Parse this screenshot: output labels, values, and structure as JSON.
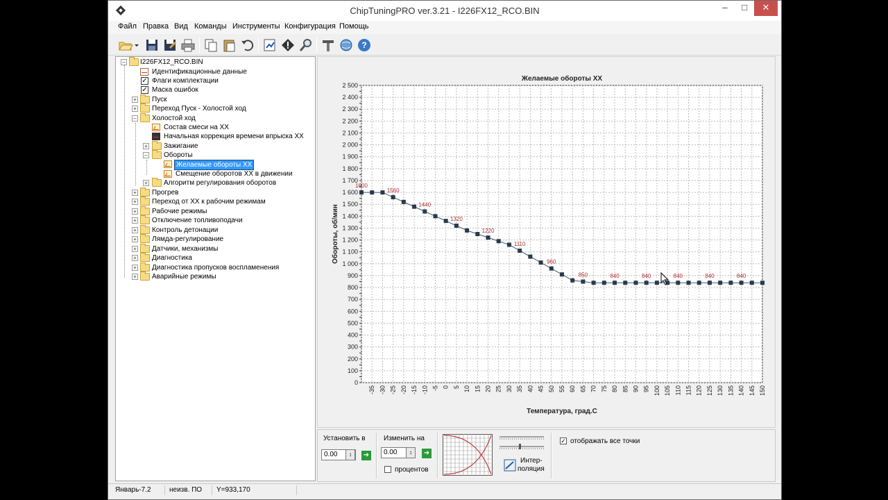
{
  "window": {
    "title": "ChipTuningPRO ver.3.21 - I226FX12_RCO.BIN"
  },
  "menu": [
    "Файл",
    "Правка",
    "Вид",
    "Команды",
    "Инструменты",
    "Конфигурация",
    "Помощь"
  ],
  "toolbar": {
    "icons": [
      "open-icon",
      "dropdown-arrow-icon",
      "save-icon",
      "save-as-icon",
      "print-icon",
      "copy-icon",
      "paste-icon",
      "undo-icon",
      "edit-map-icon",
      "checksum-icon",
      "search-icon",
      "tools-icon",
      "globe-icon",
      "help-icon"
    ]
  },
  "tree": {
    "root": "I226FX12_RCO.BIN",
    "items": [
      {
        "label": "Идентификационные данные"
      },
      {
        "label": "Флаги комплектации"
      },
      {
        "label": "Маска ошибок"
      },
      {
        "label": "Пуск"
      },
      {
        "label": "Переход Пуск - Холостой ход"
      },
      {
        "label": "Холостой ход"
      },
      {
        "label": "Состав смеси на ХХ"
      },
      {
        "label": "Начальная коррекция времени впрыска ХХ"
      },
      {
        "label": "Зажигание"
      },
      {
        "label": "Обороты"
      },
      {
        "label": "Желаемые обороты ХХ"
      },
      {
        "label": "Смещение оборотов ХХ в движении"
      },
      {
        "label": "Алгоритм регулирования оборотов"
      },
      {
        "label": "Прогрев"
      },
      {
        "label": "Переход от ХХ к рабочим режимам"
      },
      {
        "label": "Рабочие режимы"
      },
      {
        "label": "Отключение топливоподачи"
      },
      {
        "label": "Контроль детонации"
      },
      {
        "label": "Лямда-регулирование"
      },
      {
        "label": "Датчики, механизмы"
      },
      {
        "label": "Диагностика"
      },
      {
        "label": "Диагностика пропусков воспламенения"
      },
      {
        "label": "Аварийные режимы"
      }
    ]
  },
  "chart_data": {
    "type": "line",
    "title": "Желаемые обороты ХХ",
    "xlabel": "Температура, град.С",
    "ylabel": "Обороты, об/мин",
    "x": [
      -40,
      -35,
      -30,
      -25,
      -20,
      -15,
      -10,
      -5,
      0,
      5,
      10,
      15,
      20,
      25,
      30,
      35,
      40,
      45,
      50,
      55,
      60,
      65,
      70,
      75,
      80,
      85,
      90,
      95,
      100,
      105,
      110,
      115,
      120,
      125,
      130,
      135,
      140,
      145,
      150
    ],
    "values": [
      1600,
      1600,
      1600,
      1560,
      1520,
      1480,
      1440,
      1400,
      1360,
      1320,
      1280,
      1250,
      1220,
      1190,
      1160,
      1110,
      1060,
      1010,
      960,
      910,
      860,
      850,
      840,
      840,
      840,
      840,
      840,
      840,
      840,
      840,
      840,
      840,
      840,
      840,
      840,
      840,
      840,
      840,
      840
    ],
    "x_ticks": [
      "-35",
      "-30",
      "-25",
      "-20",
      "-15",
      "-10",
      "-5",
      "0",
      "5",
      "10",
      "15",
      "20",
      "25",
      "30",
      "35",
      "40",
      "45",
      "50",
      "55",
      "60",
      "65",
      "70",
      "75",
      "80",
      "85",
      "90",
      "95",
      "100",
      "105",
      "110",
      "115",
      "120",
      "125",
      "130",
      "135",
      "140",
      "145",
      "150"
    ],
    "y_ticks": [
      "0",
      "100",
      "200",
      "300",
      "400",
      "500",
      "600",
      "700",
      "800",
      "900",
      "1 000",
      "1 100",
      "1 200",
      "1 300",
      "1 400",
      "1 500",
      "1 600",
      "1 700",
      "1 800",
      "1 900",
      "2 000",
      "2 100",
      "2 200",
      "2 300",
      "2 400",
      "2 500"
    ],
    "point_labels": [
      {
        "index": 0,
        "text": "1600"
      },
      {
        "index": 3,
        "text": "1560"
      },
      {
        "index": 6,
        "text": "1440"
      },
      {
        "index": 9,
        "text": "1320"
      },
      {
        "index": 12,
        "text": "1220"
      },
      {
        "index": 15,
        "text": "1110"
      },
      {
        "index": 18,
        "text": "960"
      },
      {
        "index": 21,
        "text": "850"
      },
      {
        "index": 24,
        "text": "840"
      },
      {
        "index": 27,
        "text": "840"
      },
      {
        "index": 30,
        "text": "840"
      },
      {
        "index": 33,
        "text": "840"
      },
      {
        "index": 36,
        "text": "840"
      }
    ],
    "xlim": [
      -40,
      150
    ],
    "ylim": [
      0,
      2500
    ],
    "grid": true,
    "line_color": "#3a5a7a",
    "marker_color": "#2a3a4a",
    "label_color": "#b03030"
  },
  "bottom_panel": {
    "set_label": "Установить в",
    "set_value": "0.00",
    "change_label": "Изменить на",
    "change_value": "0.00",
    "percent_label": "процентов",
    "interp_label_1": "Интер-",
    "interp_label_2": "поляция",
    "show_all_label": "отображать все точки",
    "show_all_checked": true
  },
  "status": {
    "firmware": "Январь-7.2",
    "software": "неизв. ПО",
    "coord": "Y=933,170"
  }
}
